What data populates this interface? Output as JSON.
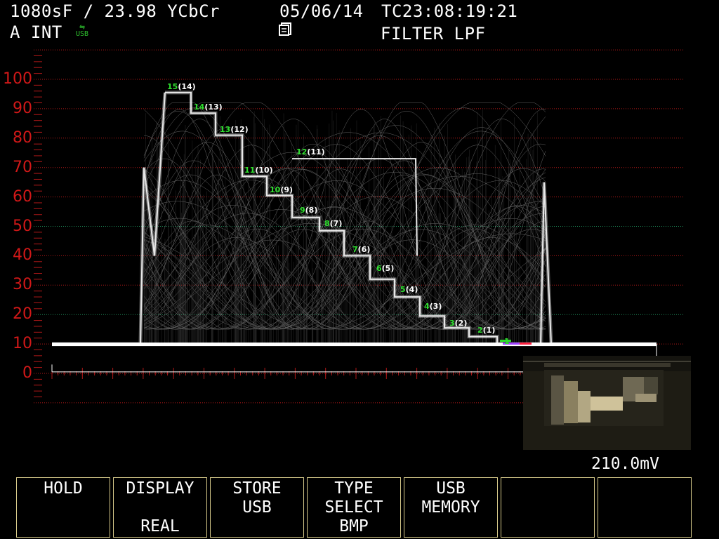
{
  "header": {
    "format": "1080sF / 23.98 YCbCr",
    "date": "05/06/14",
    "timecode": "TC23:08:19:21",
    "input": "A INT",
    "usb_indicator": "USB",
    "filter": "FILTER LPF"
  },
  "scale": {
    "labels": [
      "100",
      "90",
      "80",
      "70",
      "60",
      "50",
      "40",
      "30",
      "20",
      "10",
      "0"
    ],
    "label_color": "#d11818",
    "grid_color": "#b01818",
    "guide_color": "#1e8c5a"
  },
  "steps": [
    {
      "num": "15",
      "paren": "(14)"
    },
    {
      "num": "14",
      "paren": "(13)"
    },
    {
      "num": "13",
      "paren": "(12)"
    },
    {
      "num": "11",
      "paren": "(10)"
    },
    {
      "num": "10",
      "paren": "(9)"
    },
    {
      "num": "12",
      "paren": "(11)"
    },
    {
      "num": "9",
      "paren": "(8)"
    },
    {
      "num": "8",
      "paren": "(7)"
    },
    {
      "num": "7",
      "paren": "(6)"
    },
    {
      "num": "6",
      "paren": "(5)"
    },
    {
      "num": "5",
      "paren": "(4)"
    },
    {
      "num": "4",
      "paren": "(3)"
    },
    {
      "num": "3",
      "paren": "(2)"
    },
    {
      "num": "2",
      "paren": "(1)"
    },
    {
      "num": "1",
      "paren": ""
    }
  ],
  "readout": "210.0mV",
  "softkeys": [
    {
      "l1": "HOLD",
      "l2": "",
      "l3": ""
    },
    {
      "l1": "DISPLAY",
      "l2": "",
      "l3": "REAL"
    },
    {
      "l1": "STORE",
      "l2": "USB",
      "l3": ""
    },
    {
      "l1": "TYPE",
      "l2": "SELECT",
      "l3": "BMP"
    },
    {
      "l1": "USB",
      "l2": "MEMORY",
      "l3": ""
    },
    {
      "l1": "",
      "l2": "",
      "l3": ""
    },
    {
      "l1": "",
      "l2": "",
      "l3": ""
    }
  ],
  "colors": {
    "step_number": "#2ee02e",
    "trace": "#e8e8e8",
    "key_border": "#d6c98a"
  }
}
